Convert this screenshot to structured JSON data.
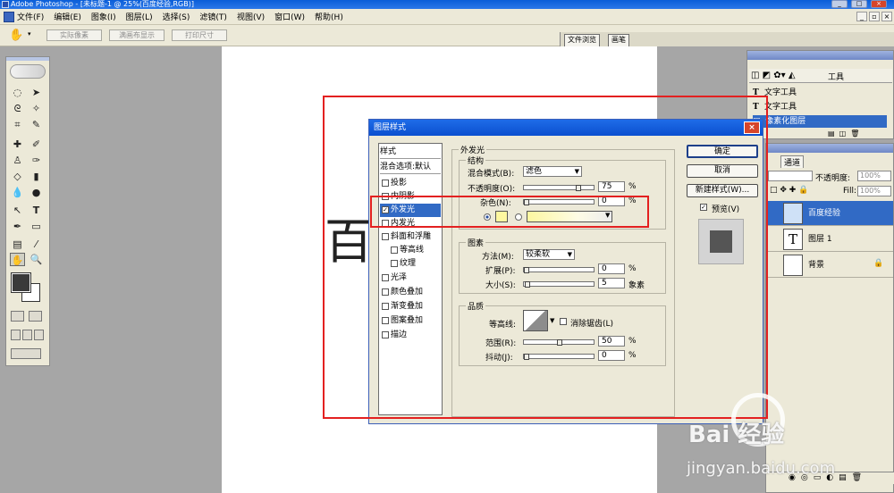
{
  "window": {
    "title": "Adobe Photoshop - [未标题-1 @ 25%(百度经验,RGB)]"
  },
  "menu": [
    "文件(F)",
    "编辑(E)",
    "图象(I)",
    "图层(L)",
    "选择(S)",
    "滤镜(T)",
    "视图(V)",
    "窗口(W)",
    "帮助(H)"
  ],
  "options_bar": {
    "buttons": [
      "实际像素",
      "满画布显示",
      "打印尺寸"
    ]
  },
  "palette_well": {
    "tabs": [
      "文件浏览",
      "画笔"
    ]
  },
  "history_panel": {
    "tab": "工具",
    "items": [
      {
        "label": "文字工具",
        "active": false
      },
      {
        "label": "文字工具",
        "active": false
      },
      {
        "label": "像素化图层",
        "active": true
      }
    ]
  },
  "layers_panel": {
    "tabs": [
      "通道"
    ],
    "opacity_label": "不透明度:",
    "opacity_value": "100%",
    "fill_label": "Fill:",
    "fill_value": "100%",
    "layers": [
      {
        "name": "百度经验",
        "selected": true
      },
      {
        "name": "图层 1",
        "selected": false
      },
      {
        "name": "背景",
        "selected": false
      }
    ]
  },
  "canvas": {
    "text": "百"
  },
  "dialog": {
    "title": "图层样式",
    "styles_header": "样式",
    "blend_options": "混合选项:默认",
    "styles": [
      {
        "label": "投影",
        "checked": false,
        "indent": false,
        "active": false
      },
      {
        "label": "内阴影",
        "checked": false,
        "indent": false,
        "active": false
      },
      {
        "label": "外发光",
        "checked": true,
        "indent": false,
        "active": true
      },
      {
        "label": "内发光",
        "checked": false,
        "indent": false,
        "active": false
      },
      {
        "label": "斜面和浮雕",
        "checked": false,
        "indent": false,
        "active": false
      },
      {
        "label": "等高线",
        "checked": false,
        "indent": true,
        "active": false
      },
      {
        "label": "纹理",
        "checked": false,
        "indent": true,
        "active": false
      },
      {
        "label": "光泽",
        "checked": false,
        "indent": false,
        "active": false
      },
      {
        "label": "颜色叠加",
        "checked": false,
        "indent": false,
        "active": false
      },
      {
        "label": "渐变叠加",
        "checked": false,
        "indent": false,
        "active": false
      },
      {
        "label": "图案叠加",
        "checked": false,
        "indent": false,
        "active": false
      },
      {
        "label": "描边",
        "checked": false,
        "indent": false,
        "active": false
      }
    ],
    "section_title": "外发光",
    "structure": {
      "title": "结构",
      "blend_mode_label": "混合模式(B):",
      "blend_mode_value": "滤色",
      "opacity_label": "不透明度(O):",
      "opacity_value": "75",
      "noise_label": "杂色(N):",
      "noise_value": "0",
      "percent": "%"
    },
    "elements": {
      "title": "图素",
      "method_label": "方法(M):",
      "method_value": "较柔软",
      "spread_label": "扩展(P):",
      "spread_value": "0",
      "size_label": "大小(S):",
      "size_value": "5",
      "size_unit": "象素",
      "percent": "%"
    },
    "quality": {
      "title": "品质",
      "contour_label": "等高线:",
      "antialias_label": "消除锯齿(L)",
      "range_label": "范围(R):",
      "range_value": "50",
      "jitter_label": "抖动(J):",
      "jitter_value": "0",
      "percent": "%"
    },
    "buttons": {
      "ok": "确定",
      "cancel": "取消",
      "new_style": "新建样式(W)...",
      "preview": "预览(V)"
    }
  },
  "watermark": {
    "cn": "Bai 经验",
    "en": "jingyan.baidu.com"
  },
  "colors": {
    "glow_swatch": "#fdf7a0",
    "selection_blue": "#316ac5",
    "highlight_red": "#e32020"
  }
}
